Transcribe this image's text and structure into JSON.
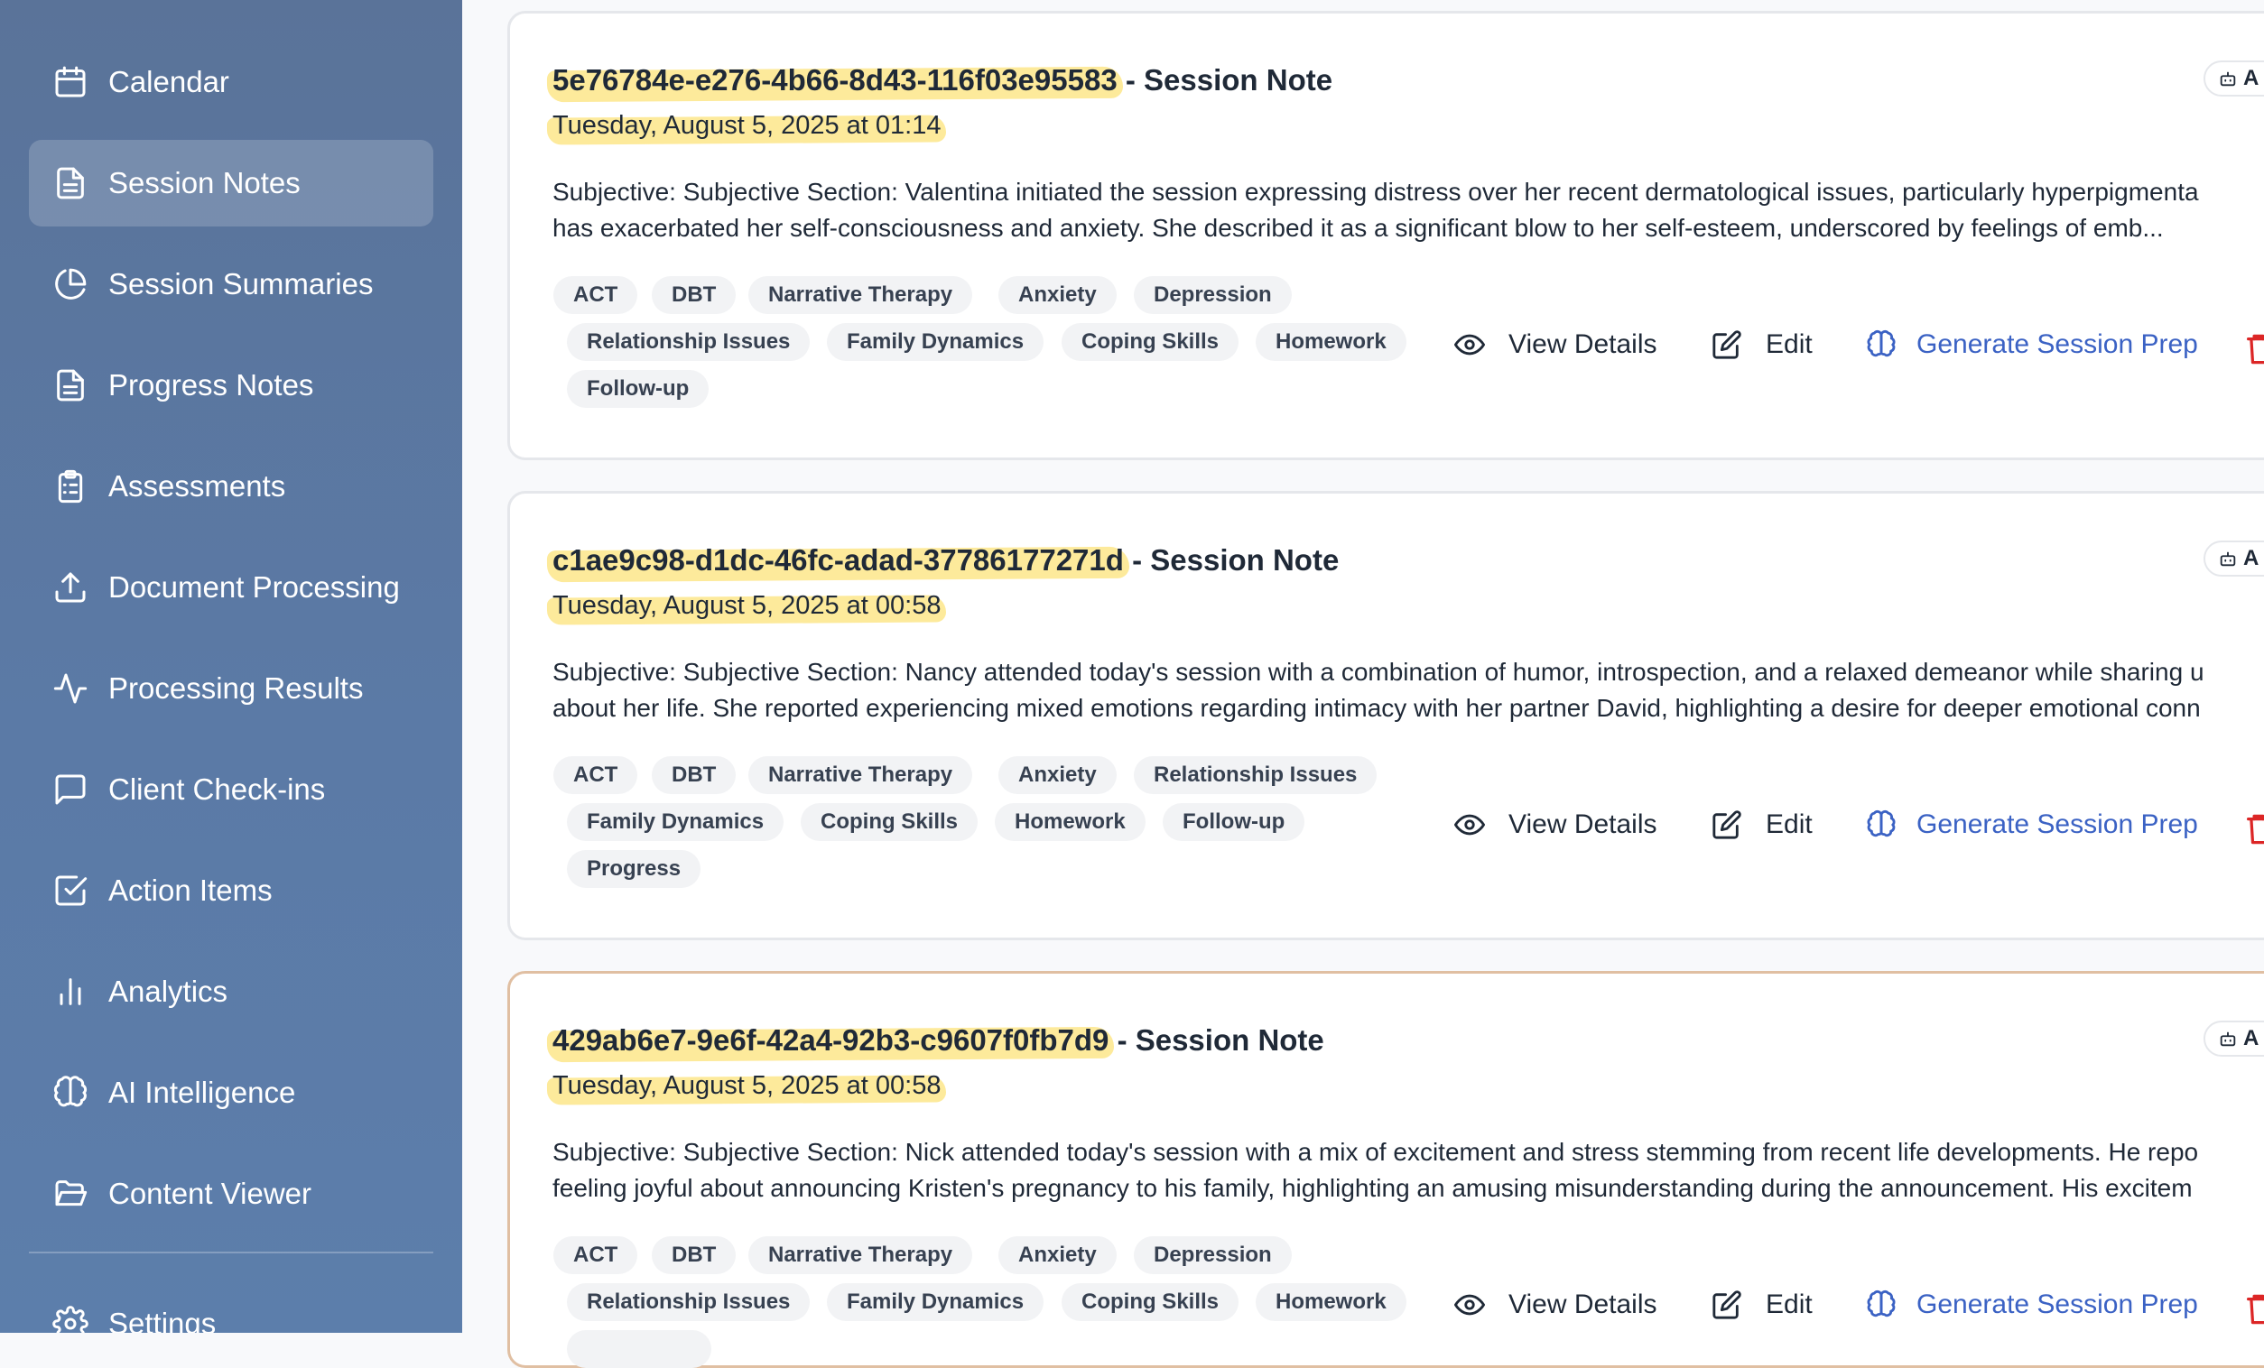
{
  "sidebar": {
    "items": [
      {
        "label": "Calendar",
        "icon": "calendar-icon",
        "active": false
      },
      {
        "label": "Session Notes",
        "icon": "document-icon",
        "active": true
      },
      {
        "label": "Session Summaries",
        "icon": "pie-chart-icon",
        "active": false
      },
      {
        "label": "Progress Notes",
        "icon": "document-icon",
        "active": false
      },
      {
        "label": "Assessments",
        "icon": "clipboard-list-icon",
        "active": false
      },
      {
        "label": "Document Processing",
        "icon": "upload-icon",
        "active": false
      },
      {
        "label": "Processing Results",
        "icon": "activity-icon",
        "active": false
      },
      {
        "label": "Client Check-ins",
        "icon": "message-square-icon",
        "active": false
      },
      {
        "label": "Action Items",
        "icon": "check-square-icon",
        "active": false
      },
      {
        "label": "Analytics",
        "icon": "bar-chart-icon",
        "active": false
      },
      {
        "label": "AI Intelligence",
        "icon": "brain-icon",
        "active": false
      },
      {
        "label": "Content Viewer",
        "icon": "folder-open-icon",
        "active": false
      },
      {
        "label": "Settings",
        "icon": "gear-icon",
        "active": false
      }
    ]
  },
  "actions": {
    "view_details": "View Details",
    "edit": "Edit",
    "generate_prep": "Generate Session Prep",
    "ai_badge": "A"
  },
  "notes": [
    {
      "id": "5e76784e-e276-4b66-8d43-116f03e95583",
      "title_suffix": "- Session Note",
      "date": "Tuesday, August 5, 2025 at 01:14",
      "summary_line1": "Subjective: Subjective Section: Valentina initiated the session expressing distress over her recent dermatological issues, particularly hyperpigmenta",
      "summary_line2": "has exacerbated her self-consciousness and anxiety. She described it as a significant blow to her self-esteem, underscored by feelings of emb...",
      "tags": [
        "ACT",
        "DBT",
        "Narrative Therapy",
        "Anxiety",
        "Depression",
        "Relationship Issues",
        "Family Dynamics",
        "Coping Skills",
        "Homework",
        "Follow-up"
      ]
    },
    {
      "id": "c1ae9c98-d1dc-46fc-adad-37786177271d",
      "title_suffix": "- Session Note",
      "date": "Tuesday, August 5, 2025 at 00:58",
      "summary_line1": "Subjective: Subjective Section: Nancy attended today's session with a combination of humor, introspection, and a relaxed demeanor while sharing u",
      "summary_line2": "about her life. She reported experiencing mixed emotions regarding intimacy with her partner David, highlighting a desire for deeper emotional conn",
      "tags": [
        "ACT",
        "DBT",
        "Narrative Therapy",
        "Anxiety",
        "Relationship Issues",
        "Family Dynamics",
        "Coping Skills",
        "Homework",
        "Follow-up",
        "Progress"
      ]
    },
    {
      "id": "429ab6e7-9e6f-42a4-92b3-c9607f0fb7d9",
      "title_suffix": "- Session Note",
      "date": "Tuesday, August 5, 2025 at 00:58",
      "summary_line1": "Subjective: Subjective Section: Nick attended today's session with a mix of excitement and stress stemming from recent life developments. He repo",
      "summary_line2": "feeling joyful about announcing Kristen's pregnancy to his family, highlighting an amusing misunderstanding during the announcement. His excitem",
      "tags": [
        "ACT",
        "DBT",
        "Narrative Therapy",
        "Anxiety",
        "Depression",
        "Relationship Issues",
        "Family Dynamics",
        "Coping Skills",
        "Homework"
      ]
    }
  ],
  "colors": {
    "sidebar": "#5b7aa6",
    "highlight": "#fde68a",
    "link": "#3b62c4",
    "danger": "#dc2626"
  }
}
